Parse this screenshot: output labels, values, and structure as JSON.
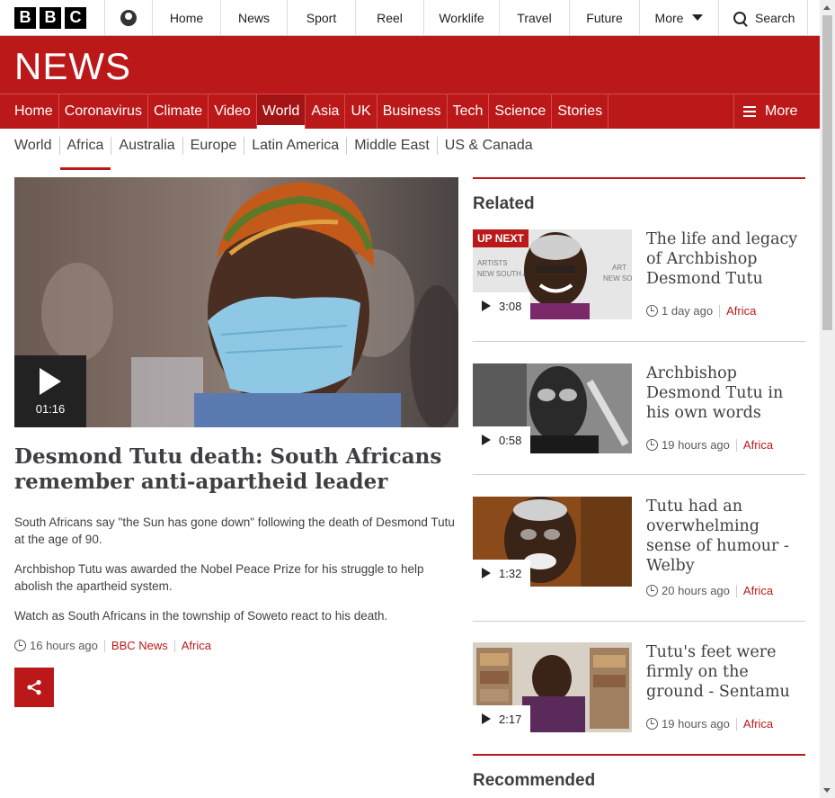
{
  "bbc_bar": {
    "logo_letters": [
      "B",
      "B",
      "C"
    ],
    "nav": [
      "Home",
      "News",
      "Sport",
      "Reel",
      "Worklife",
      "Travel",
      "Future",
      "More"
    ],
    "search_label": "Search"
  },
  "brand": {
    "title": "NEWS"
  },
  "main_nav": {
    "items": [
      "Home",
      "Coronavirus",
      "Climate",
      "Video",
      "World",
      "Asia",
      "UK",
      "Business",
      "Tech",
      "Science",
      "Stories"
    ],
    "active": "World",
    "more_label": "More"
  },
  "sub_nav": {
    "items": [
      "World",
      "Africa",
      "Australia",
      "Europe",
      "Latin America",
      "Middle East",
      "US & Canada"
    ],
    "active": "Africa"
  },
  "story": {
    "duration": "01:16",
    "headline": "Desmond Tutu death: South Africans remember anti-apartheid leader",
    "paragraphs": [
      "South Africans say \"the Sun has gone down\" following the death of Desmond Tutu at the age of 90.",
      "Archbishop Tutu was awarded the Nobel Peace Prize for his struggle to help abolish the apartheid system.",
      "Watch as South Africans in the township of Soweto react to his death."
    ],
    "time": "16 hours ago",
    "source": "BBC News",
    "section": "Africa"
  },
  "related": {
    "heading": "Related",
    "up_next_label": "UP NEXT",
    "items": [
      {
        "title": "The life and legacy of Archbishop Desmond Tutu",
        "duration": "3:08",
        "time": "1 day ago",
        "section": "Africa"
      },
      {
        "title": "Archbishop Desmond Tutu in his own words",
        "duration": "0:58",
        "time": "19 hours ago",
        "section": "Africa"
      },
      {
        "title": "Tutu had an overwhelming sense of humour - Welby",
        "duration": "1:32",
        "time": "20 hours ago",
        "section": "Africa"
      },
      {
        "title": "Tutu's feet were firmly on the ground - Sentamu",
        "duration": "2:17",
        "time": "19 hours ago",
        "section": "Africa"
      }
    ]
  },
  "recommended": {
    "heading": "Recommended"
  }
}
